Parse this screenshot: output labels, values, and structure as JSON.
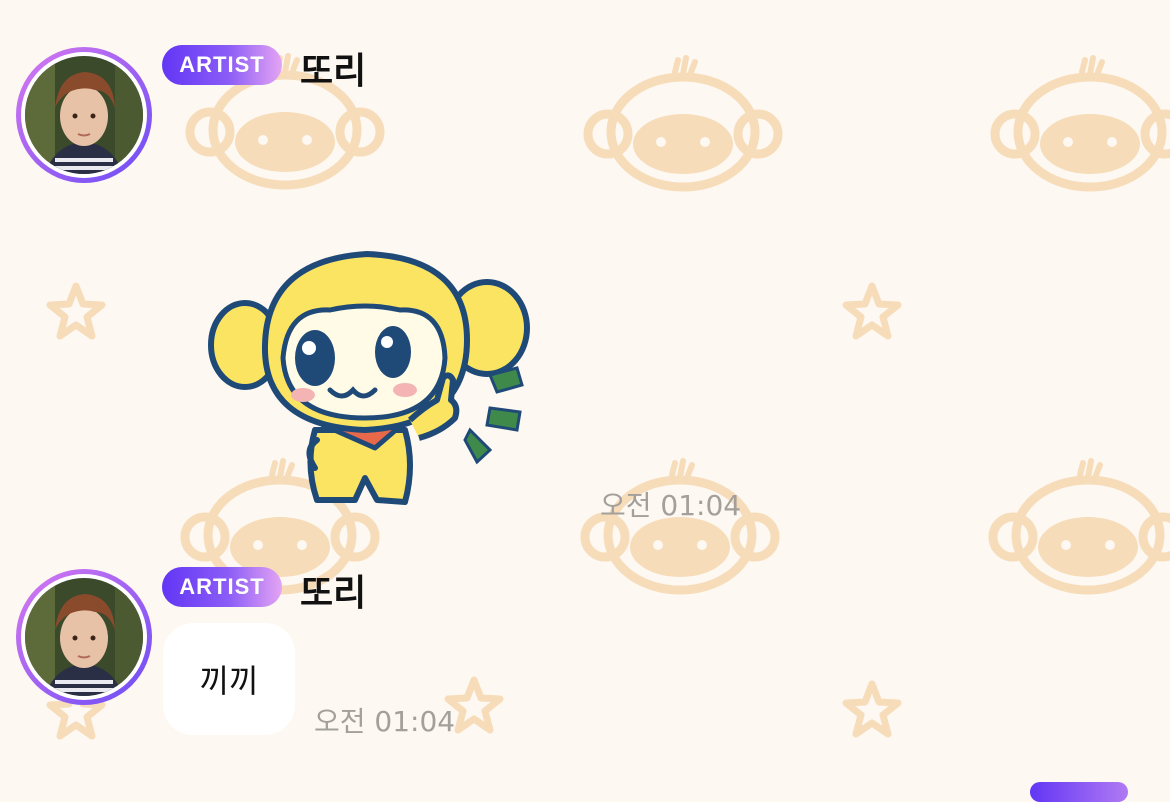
{
  "messages": [
    {
      "badge": "ARTIST",
      "sender": "또리",
      "type": "sticker",
      "sticker": "monkey-pointing-sticker",
      "time": "오전 01:04"
    },
    {
      "badge": "ARTIST",
      "sender": "또리",
      "type": "text",
      "text": "끼끼",
      "time": "오전 01:04"
    }
  ],
  "colors": {
    "background": "#fdf8f1",
    "pattern": "#f7dcba",
    "badge_start": "#6236f5",
    "badge_end": "#e3a4f3",
    "time_text": "#a3a09c",
    "bubble": "#ffffff"
  }
}
